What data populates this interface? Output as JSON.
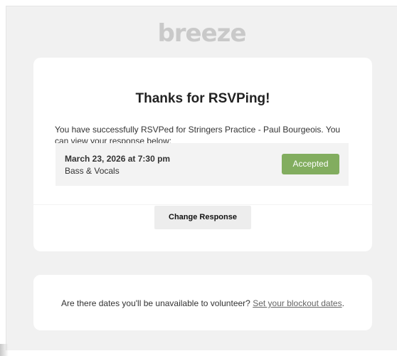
{
  "logo": {
    "text": "breeze"
  },
  "rsvp": {
    "title": "Thanks for RSVPing!",
    "message": "You have successfully RSVPed for Stringers Practice - Paul Bourgeois. You can view your response below:",
    "response": {
      "date": "March 23, 2026 at 7:30 pm",
      "role": "Bass & Vocals",
      "status": "Accepted"
    },
    "change_button": "Change Response"
  },
  "blockout": {
    "question": "Are there dates you'll be unavailable to volunteer?",
    "link": "Set your blockout dates",
    "suffix": "."
  },
  "colors": {
    "accepted": "#82ad5f",
    "page_background": "#f1f1f1",
    "card_background": "#ffffff",
    "logo": "#c9c9c9"
  }
}
